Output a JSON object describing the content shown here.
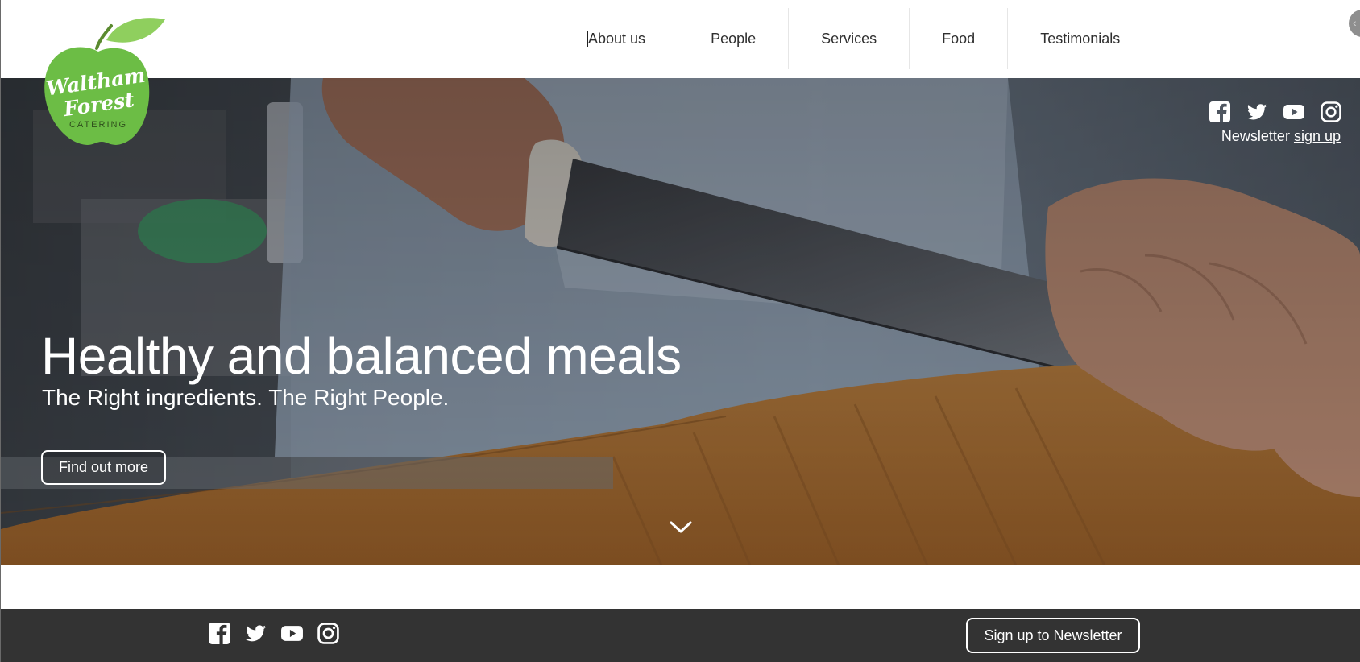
{
  "brand": {
    "name_line1": "Waltham",
    "name_line2": "Forest",
    "tagline": "CATERING",
    "color_green": "#6cbd45",
    "color_leaf": "#8fcf5e"
  },
  "nav": {
    "items": [
      {
        "label": "About us"
      },
      {
        "label": "People"
      },
      {
        "label": "Services"
      },
      {
        "label": "Food"
      },
      {
        "label": "Testimonials"
      }
    ]
  },
  "hero": {
    "title": "Healthy and balanced meals",
    "subtitle": "The Right ingredients. The Right People.",
    "cta_label": "Find out more",
    "newsletter_text": "Newsletter",
    "newsletter_link": "sign up",
    "social_icons": [
      "facebook-icon",
      "twitter-icon",
      "youtube-icon",
      "instagram-icon"
    ]
  },
  "footer": {
    "social_icons": [
      "facebook-icon",
      "twitter-icon",
      "youtube-icon",
      "instagram-icon"
    ],
    "button_label": "Sign up to Newsletter",
    "background": "#333333"
  }
}
